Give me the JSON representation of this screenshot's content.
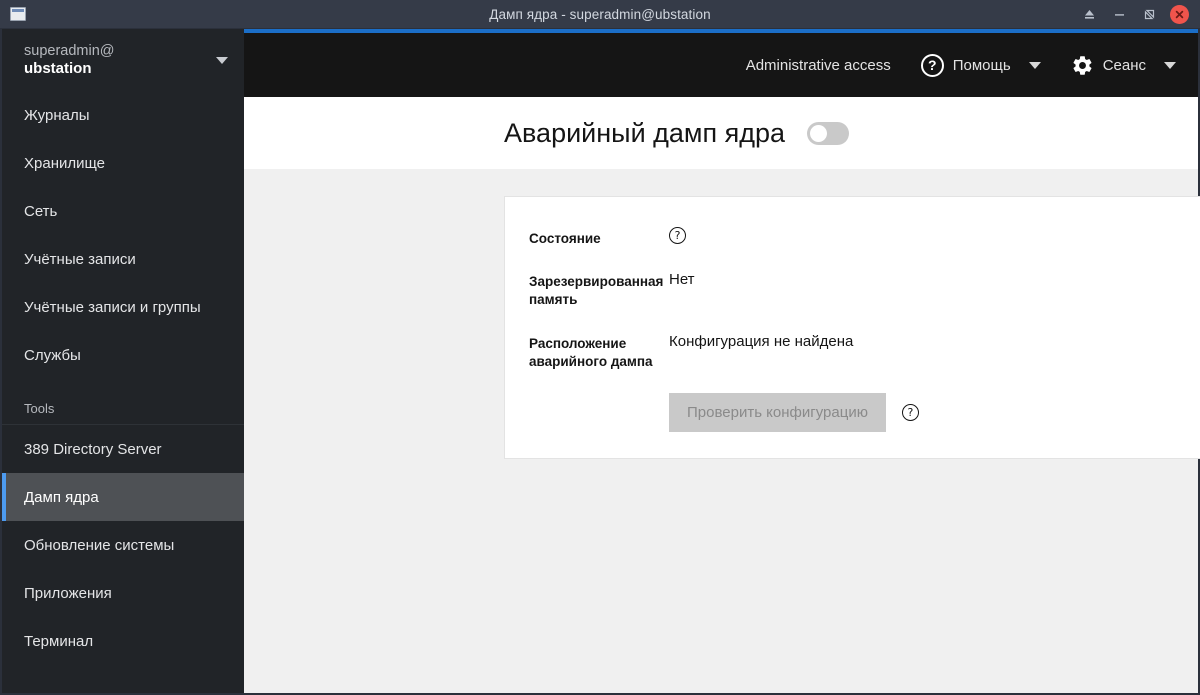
{
  "window": {
    "title": "Дамп ядра - superadmin@ubstation",
    "app_icon": "window-icon",
    "buttons": {
      "eject_label": "⏏",
      "minimize_label": "—",
      "maximize_label": "❐",
      "close_label": "✕"
    }
  },
  "sidebar": {
    "account": {
      "user": "superadmin@",
      "host": "ubstation",
      "caret_icon": "chevron-down-icon"
    },
    "items": [
      {
        "label": "Журналы",
        "selected": false
      },
      {
        "label": "Хранилище",
        "selected": false
      },
      {
        "label": "Сеть",
        "selected": false
      },
      {
        "label": "Учётные записи",
        "selected": false
      },
      {
        "label": "Учётные записи и группы",
        "selected": false
      },
      {
        "label": "Службы",
        "selected": false
      }
    ],
    "section_label": "Tools",
    "tools": [
      {
        "label": "389 Directory Server",
        "selected": false
      },
      {
        "label": "Дамп ядра",
        "selected": true
      },
      {
        "label": "Обновление системы",
        "selected": false
      },
      {
        "label": "Приложения",
        "selected": false
      },
      {
        "label": "Терминал",
        "selected": false
      }
    ],
    "accent_color": "#4d9bf0",
    "selected_bg": "#4e5155"
  },
  "topbar": {
    "admin_access_label": "Administrative access",
    "help_label": "Помощь",
    "help_icon": "question-circle-icon",
    "session_label": "Сеанс",
    "session_icon": "gear-icon",
    "accent_color": "#1673d6"
  },
  "page": {
    "title": "Аварийный дамп ядра",
    "toggle": {
      "name": "kdump-enable-toggle",
      "state": "off"
    }
  },
  "card": {
    "rows": [
      {
        "label": "Состояние",
        "value": "",
        "has_help_icon": true
      },
      {
        "label": "Зарезервированная память",
        "value": "Нет",
        "has_help_icon": false
      },
      {
        "label": "Расположение аварийного дампа",
        "value": "Конфигурация не найдена",
        "has_help_icon": false
      }
    ],
    "action": {
      "button_label": "Проверить конфигурацию",
      "button_disabled": true,
      "has_help_icon": true
    },
    "help_glyph": "?"
  }
}
